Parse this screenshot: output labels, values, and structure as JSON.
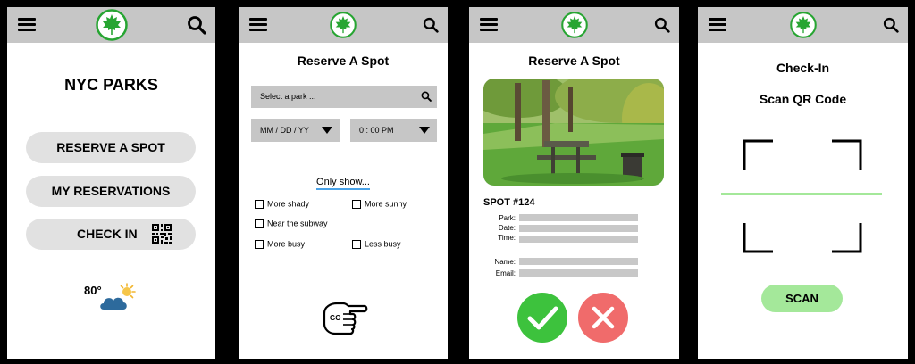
{
  "screen1": {
    "title": "NYC PARKS",
    "buttons": {
      "reserve": "RESERVE A SPOT",
      "my_reservations": "MY RESERVATIONS",
      "check_in": "CHECK IN"
    },
    "weather": {
      "temperature": "80°",
      "icon": "partly-cloudy-icon"
    }
  },
  "screen2": {
    "title": "Reserve A Spot",
    "park_search": {
      "placeholder": "Select a park ..."
    },
    "date_select": {
      "value": "MM / DD / YY"
    },
    "time_select": {
      "value": "0 : 00 PM"
    },
    "filter_link": "Only show...",
    "filters": [
      "More shady",
      "More sunny",
      "Near the subway",
      "More busy",
      "Less busy"
    ],
    "go_label": "GO"
  },
  "screen3": {
    "title": "Reserve A Spot",
    "spot": "SPOT #124",
    "fields": [
      "Park:",
      "Date:",
      "Time:",
      "Name:",
      "Email:"
    ],
    "confirm_color": "#3dc23d",
    "cancel_color": "#f06b6b"
  },
  "screen4": {
    "title": "Check-In",
    "subtitle": "Scan QR Code",
    "scan_label": "SCAN",
    "accent": "#a4e89a"
  },
  "colors": {
    "logo_green": "#27a532",
    "topbar": "#c6c6c6"
  }
}
